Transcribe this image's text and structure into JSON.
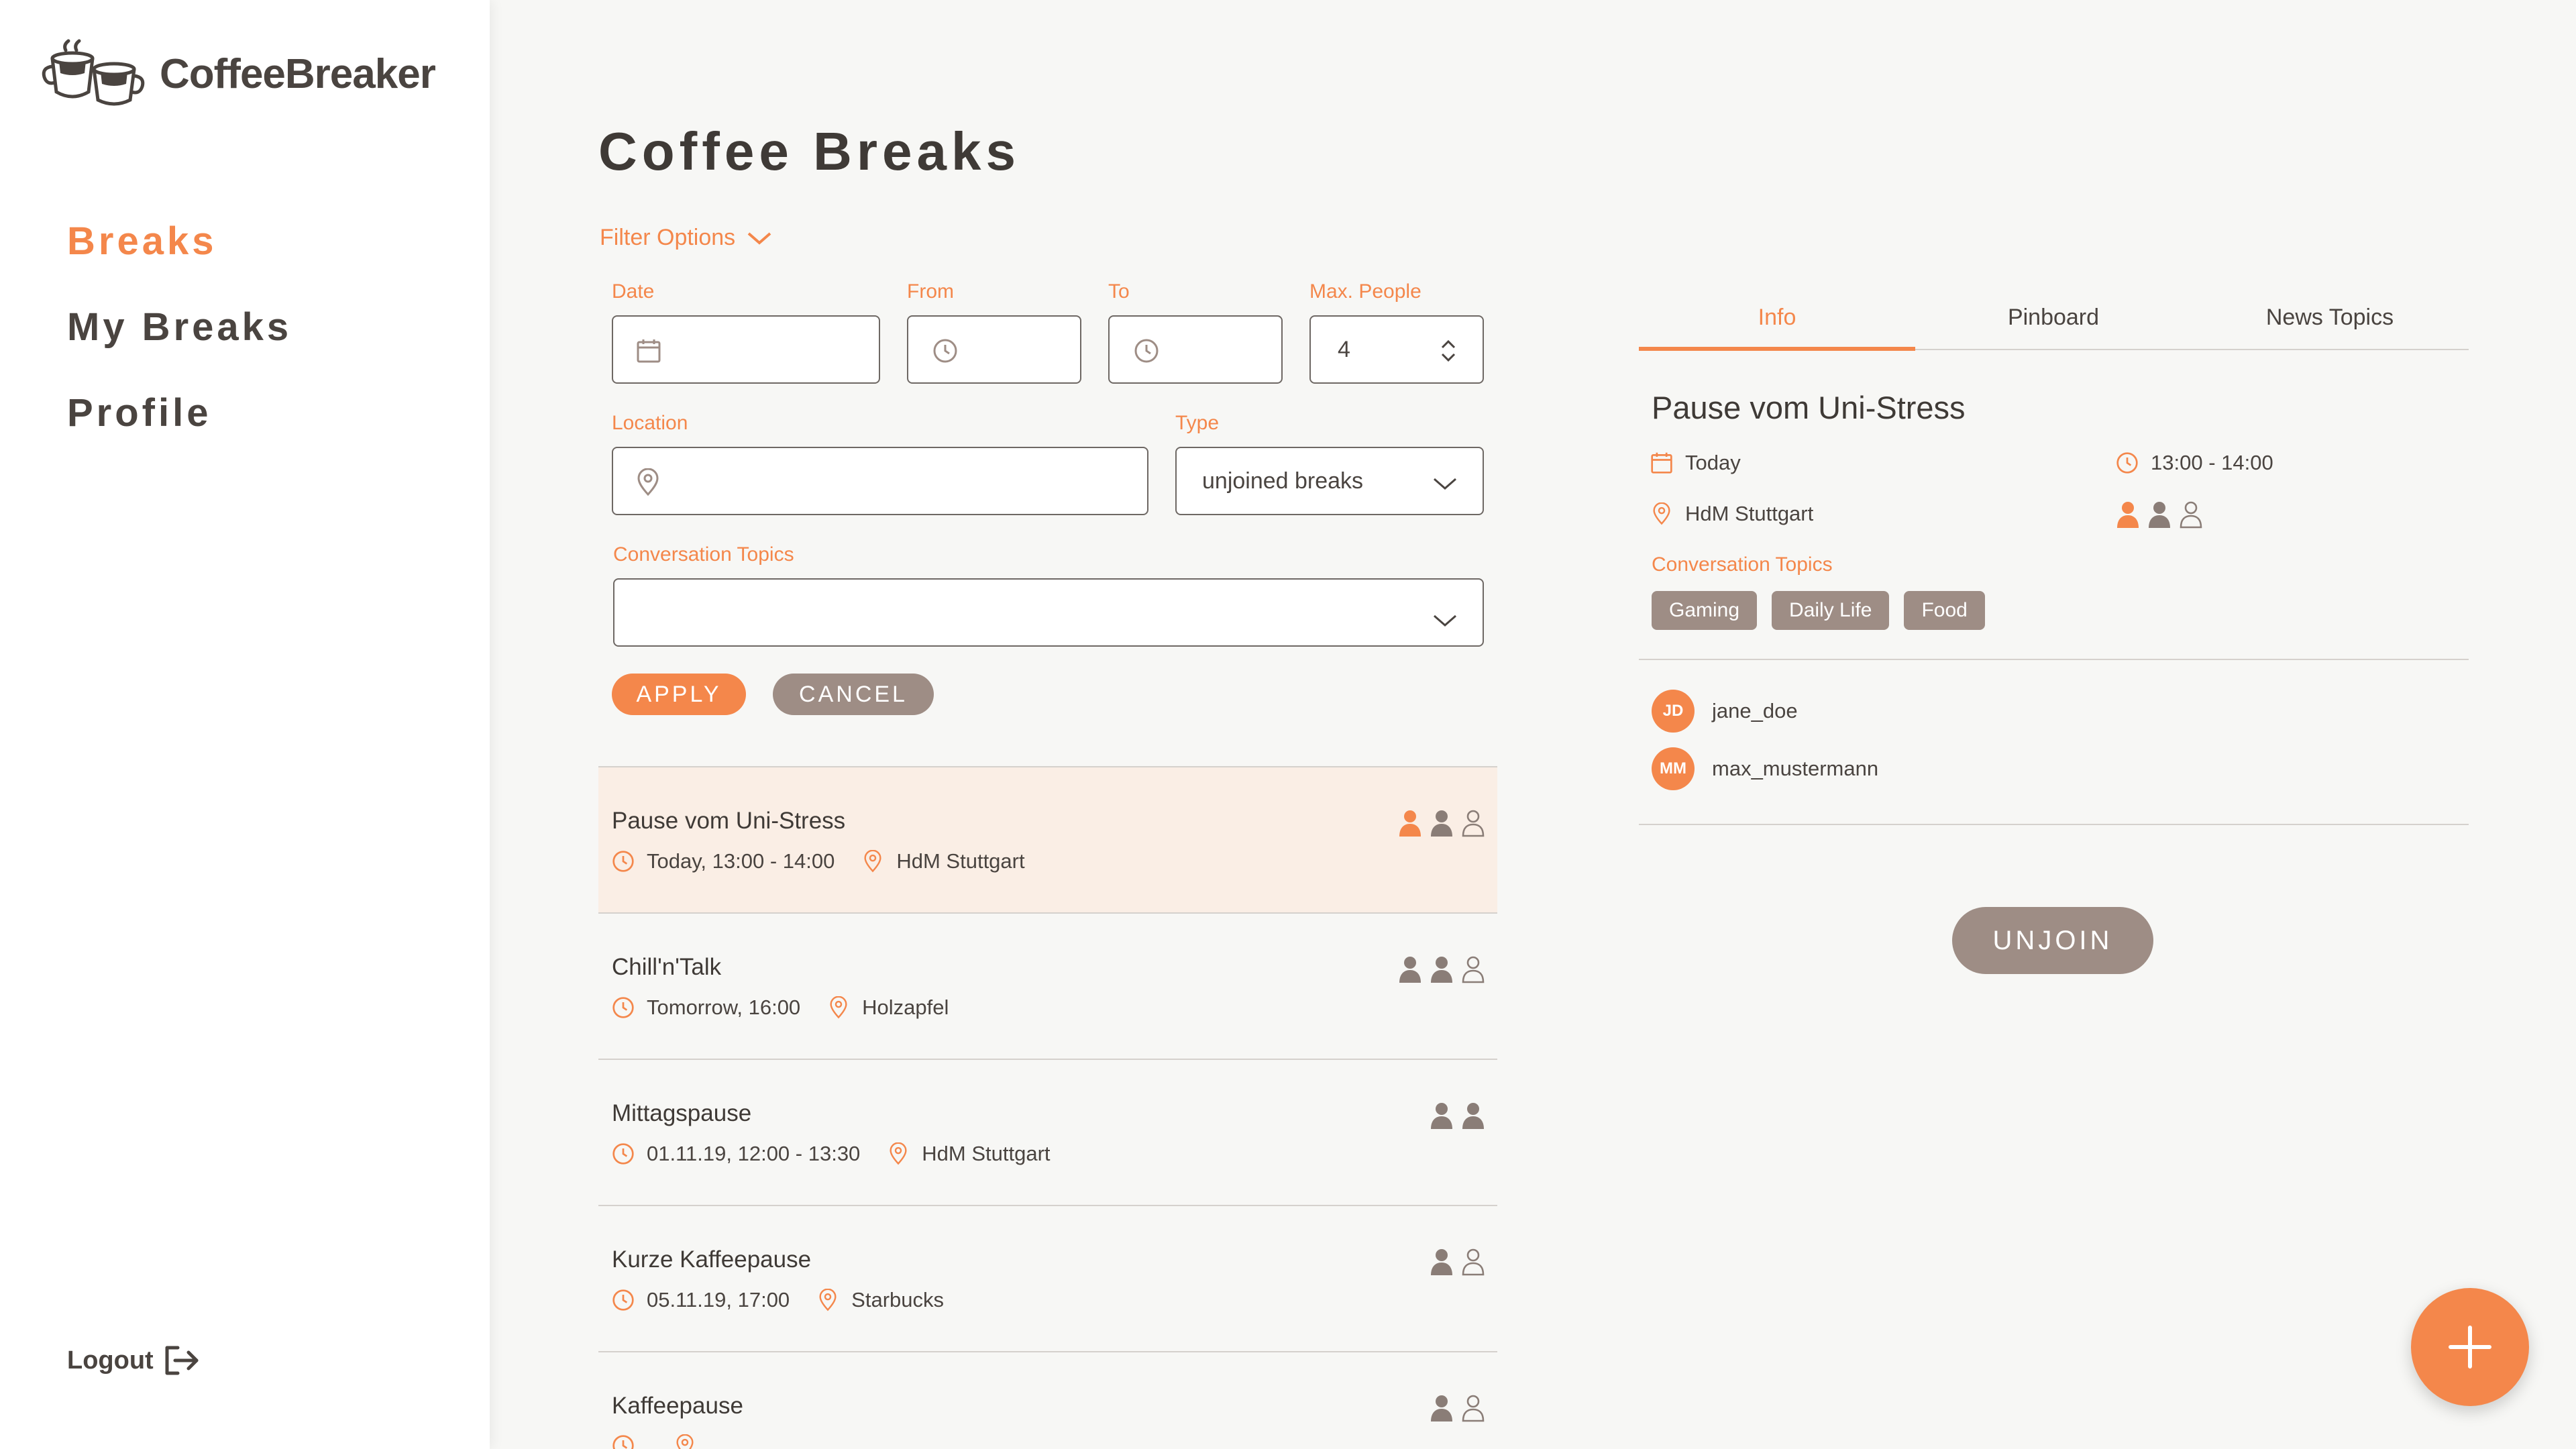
{
  "app": {
    "name": "CoffeeBreaker"
  },
  "colors": {
    "accent": "#f4874b",
    "muted": "#9e8d85",
    "text": "#4a4440",
    "selected_row": "#faeee5"
  },
  "nav": {
    "items": [
      {
        "label": "Breaks",
        "active": true
      },
      {
        "label": "My Breaks"
      },
      {
        "label": "Profile"
      }
    ],
    "logout": "Logout"
  },
  "page": {
    "title": "Coffee Breaks"
  },
  "filters": {
    "toggle": "Filter Options",
    "date_label": "Date",
    "from_label": "From",
    "to_label": "To",
    "max_people_label": "Max. People",
    "max_people_value": "4",
    "location_label": "Location",
    "type_label": "Type",
    "type_value": "unjoined breaks",
    "topics_label": "Conversation Topics",
    "apply": "APPLY",
    "cancel": "CANCEL"
  },
  "breaks": [
    {
      "title": "Pause vom Uni-Stress",
      "time": "Today, 13:00 - 14:00",
      "location": "HdM Stuttgart",
      "people": [
        "joined",
        "taken",
        "free"
      ],
      "selected": true
    },
    {
      "title": "Chill'n'Talk",
      "time": "Tomorrow, 16:00",
      "location": "Holzapfel",
      "people": [
        "taken",
        "taken",
        "free"
      ]
    },
    {
      "title": "Mittagspause",
      "time": "01.11.19, 12:00 - 13:30",
      "location": "HdM Stuttgart",
      "people": [
        "taken",
        "taken"
      ]
    },
    {
      "title": "Kurze Kaffeepause",
      "time": "05.11.19, 17:00",
      "location": "Starbucks",
      "people": [
        "taken",
        "free"
      ]
    },
    {
      "title": "Kaffeepause",
      "time": "",
      "location": "",
      "people": [
        "taken",
        "free"
      ]
    }
  ],
  "detail": {
    "tabs": [
      "Info",
      "Pinboard",
      "News Topics"
    ],
    "title": "Pause vom Uni-Stress",
    "date": "Today",
    "time": "13:00 - 14:00",
    "location": "HdM Stuttgart",
    "people": [
      "joined",
      "taken",
      "free"
    ],
    "topics_label": "Conversation Topics",
    "topics": [
      "Gaming",
      "Daily Life",
      "Food"
    ],
    "members": [
      {
        "initials": "JD",
        "name": "jane_doe"
      },
      {
        "initials": "MM",
        "name": "max_mustermann"
      }
    ],
    "unjoin": "UNJOIN"
  }
}
